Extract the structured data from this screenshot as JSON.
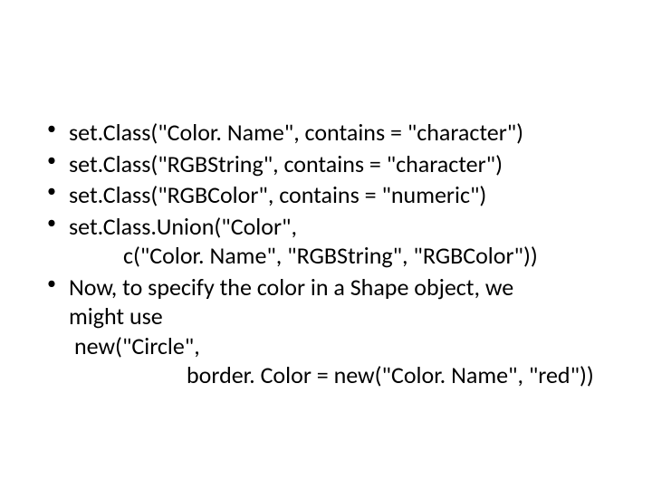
{
  "bullets": [
    {
      "line1": "set.Class(\"Color. Name\", contains = \"character\")"
    },
    {
      "line1": "set.Class(\"RGBString\", contains = \"character\")"
    },
    {
      "line1": "set.Class(\"RGBColor\", contains = \"numeric\")"
    },
    {
      "line1": "set.Class.Union(\"Color\",",
      "line2": "c(\"Color. Name\", \"RGBString\", \"RGBColor\"))"
    },
    {
      "line1": "Now, to specify the color in a Shape object, we",
      "line2": "might use",
      "line3": " new(\"Circle\",",
      "line4": "border. Color = new(\"Color. Name\", \"red\"))"
    }
  ]
}
